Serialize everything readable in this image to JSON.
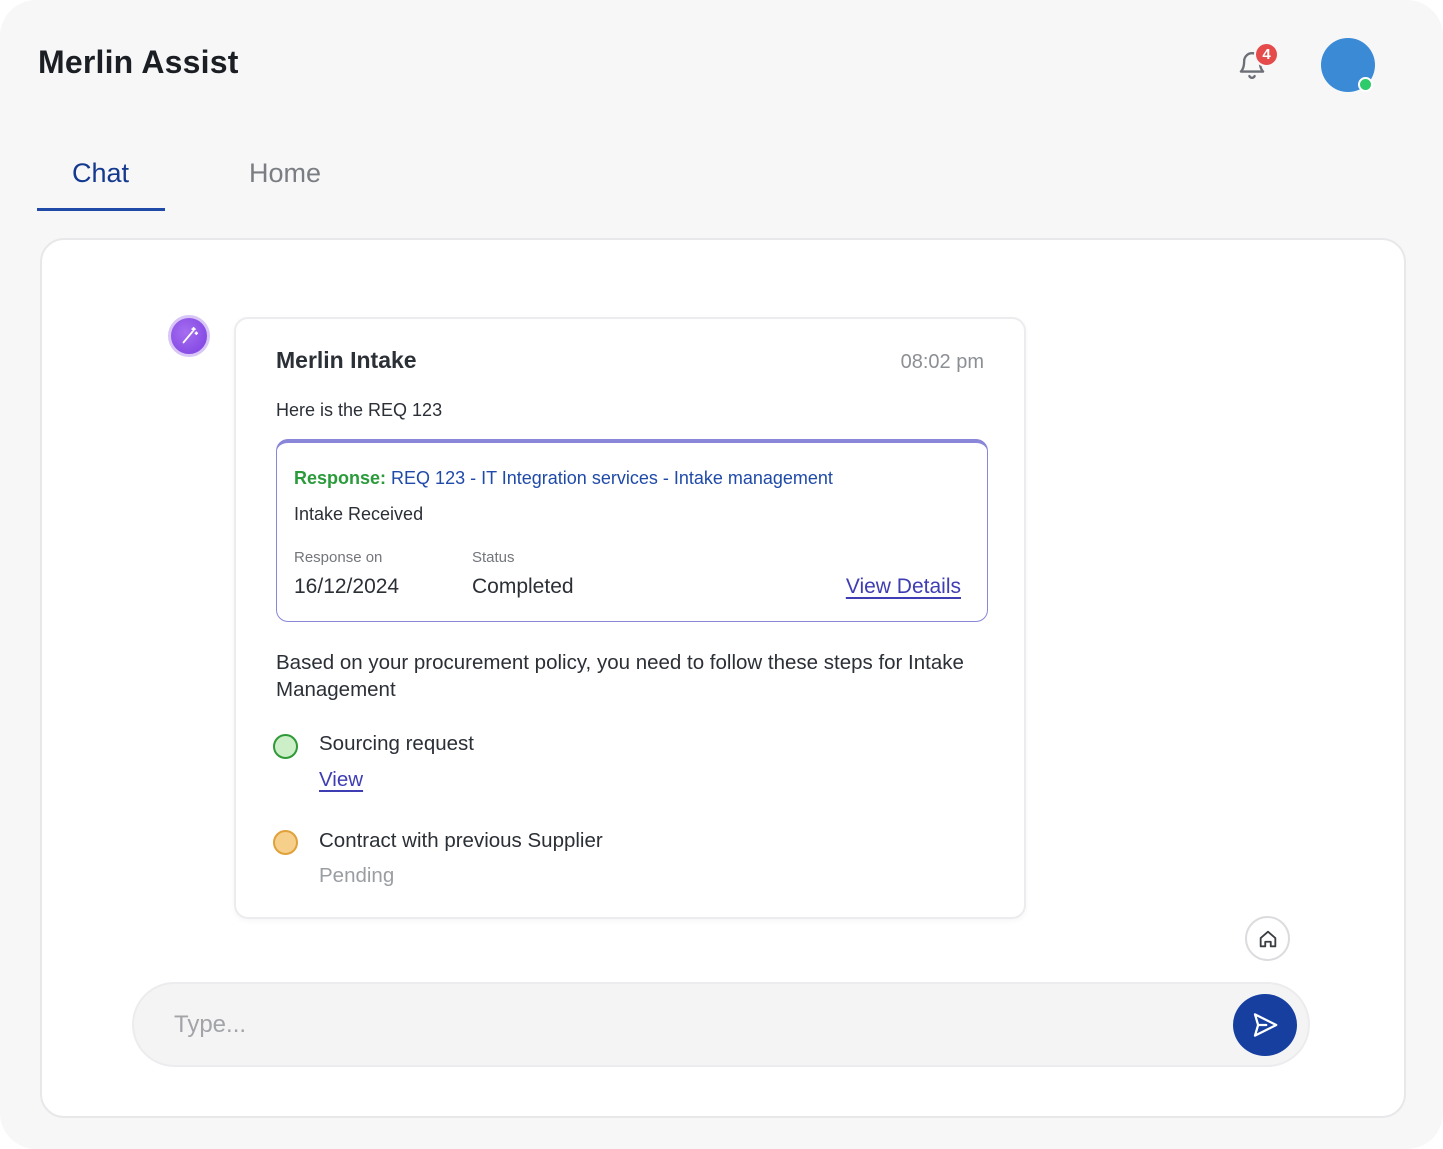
{
  "header": {
    "app_title": "Merlin Assist",
    "notification_count": "4"
  },
  "tabs": [
    {
      "label": "Chat",
      "active": true
    },
    {
      "label": "Home",
      "active": false
    }
  ],
  "message": {
    "sender": "Merlin Intake",
    "time": "08:02 pm",
    "intro": "Here is the REQ 123",
    "response_card": {
      "prefix": "Response:",
      "title": "REQ 123 - IT Integration services - Intake management",
      "subtitle": "Intake Received",
      "response_on_label": "Response on",
      "response_on_value": "16/12/2024",
      "status_label": "Status",
      "status_value": "Completed",
      "view_details_label": "View Details"
    },
    "policy_text": "Based on your procurement policy, you need to follow these steps for Intake Management",
    "steps": [
      {
        "title": "Sourcing request",
        "action": "View",
        "state": "done",
        "color": "#2f9a36"
      },
      {
        "title": "Contract with previous Supplier",
        "status": "Pending",
        "state": "pending",
        "color": "#e0a13a"
      }
    ]
  },
  "composer": {
    "placeholder": "Type..."
  },
  "colors": {
    "accent": "#163fa0",
    "tab_active": "#143a8f",
    "badge": "#e64b4b",
    "online": "#2ecb6b"
  },
  "icons": {
    "notifications": "bell-icon",
    "bot": "magic-wand-icon",
    "home": "home-icon",
    "send": "send-icon"
  }
}
